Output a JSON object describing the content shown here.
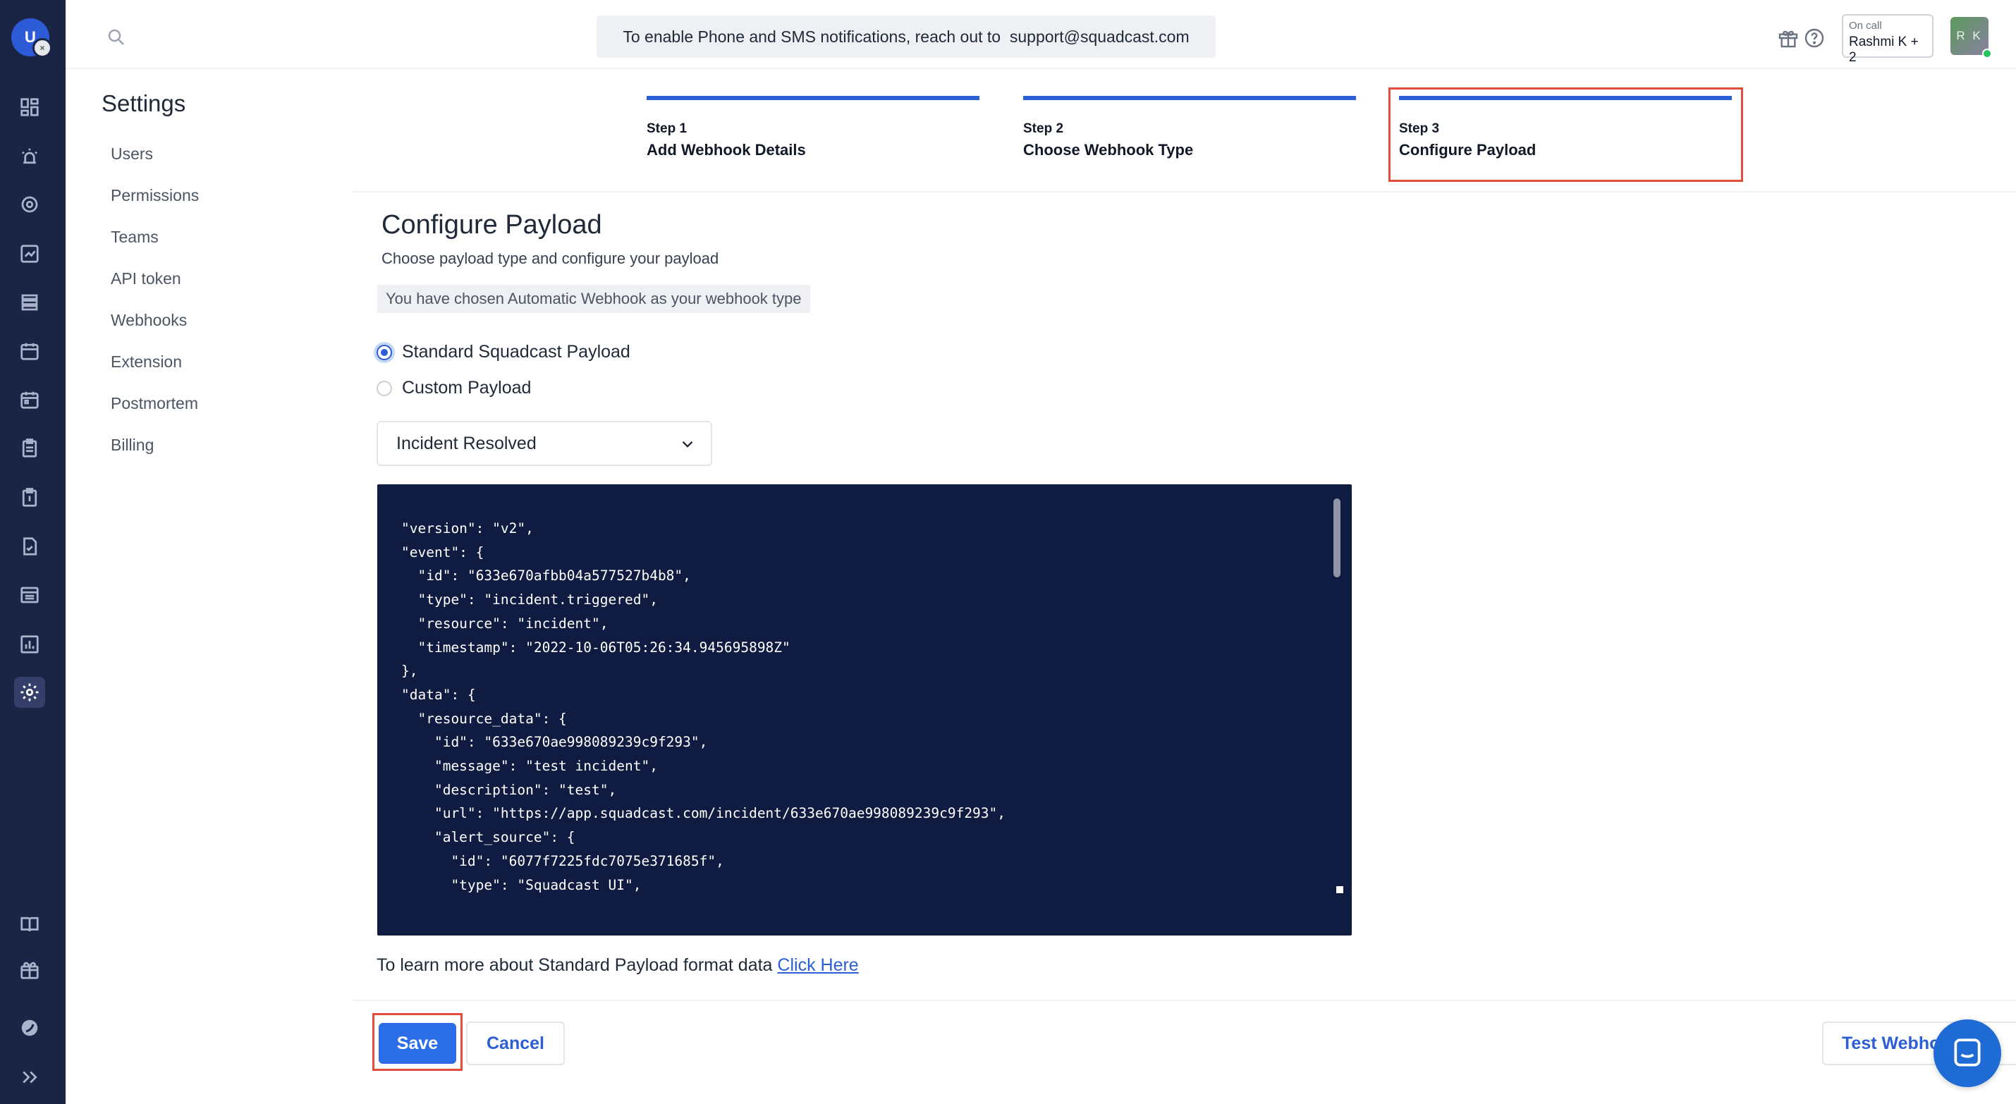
{
  "rail": {
    "user_initial": "U",
    "status_glyph": "×",
    "icons": [
      "dashboard-icon",
      "incidents-icon",
      "services-icon",
      "analytics-icon",
      "stack-icon",
      "schedule-icon",
      "calendar-icon",
      "clipboard-icon",
      "runbook-icon",
      "postmortem-icon",
      "status-page-icon",
      "reports-icon",
      "settings-icon",
      "docs-icon",
      "whats-new-icon",
      "squadcast-logo-icon",
      "expand-icon"
    ],
    "colors": {
      "background": "#1a2445",
      "active": "#34406a"
    }
  },
  "header": {
    "banner_text": "To enable Phone and SMS notifications, reach out to  support@squadcast.com",
    "oncall_label": "On call",
    "oncall_value": "Rashmi K + 2",
    "avatar_initials": "R K"
  },
  "sidebar": {
    "title": "Settings",
    "items": [
      {
        "label": "Users"
      },
      {
        "label": "Permissions"
      },
      {
        "label": "Teams"
      },
      {
        "label": "API token"
      },
      {
        "label": "Webhooks"
      },
      {
        "label": "Extension"
      },
      {
        "label": "Postmortem"
      },
      {
        "label": "Billing"
      }
    ]
  },
  "stepper": {
    "steps": [
      {
        "num": "Step 1",
        "name": "Add Webhook Details",
        "complete": true
      },
      {
        "num": "Step 2",
        "name": "Choose Webhook Type",
        "complete": true
      },
      {
        "num": "Step 3",
        "name": "Configure Payload",
        "complete": true,
        "current": true
      }
    ],
    "accent": "#2c5fd6"
  },
  "main": {
    "title": "Configure Payload",
    "subtitle": "Choose payload type and configure your payload",
    "info": "You have chosen Automatic Webhook as your webhook type",
    "payload_options": [
      {
        "label": "Standard Squadcast Payload",
        "checked": true
      },
      {
        "label": "Custom Payload",
        "checked": false
      }
    ],
    "event_select": {
      "value": "Incident Resolved"
    },
    "code_lines": [
      "\"version\": \"v2\",",
      "\"event\": {",
      "  \"id\": \"633e670afbb04a577527b4b8\",",
      "  \"type\": \"incident.triggered\",",
      "  \"resource\": \"incident\",",
      "  \"timestamp\": \"2022-10-06T05:26:34.945695898Z\"",
      "},",
      "\"data\": {",
      "  \"resource_data\": {",
      "    \"id\": \"633e670ae998089239c9f293\",",
      "    \"message\": \"test incident\",",
      "    \"description\": \"test\",",
      "    \"url\": \"https://app.squadcast.com/incident/633e670ae998089239c9f293\",",
      "    \"alert_source\": {",
      "      \"id\": \"6077f7225fdc7075e371685f\",",
      "      \"type\": \"Squadcast UI\","
    ],
    "learn_text": "To learn more about Standard Payload format data",
    "learn_link": "Click Here"
  },
  "footer": {
    "save_label": "Save",
    "cancel_label": "Cancel",
    "test_label": "Test Webhook"
  }
}
